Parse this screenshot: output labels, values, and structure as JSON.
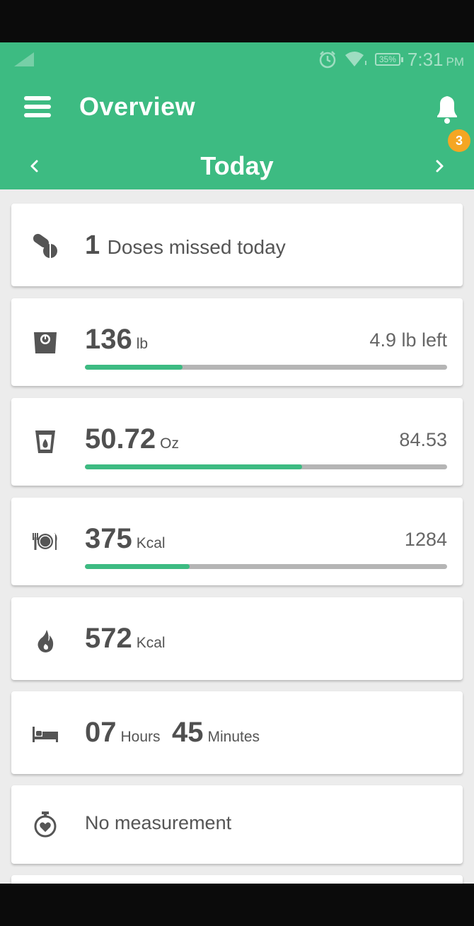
{
  "status_bar": {
    "battery": "35%",
    "time": "7:31",
    "ampm": "PM"
  },
  "header": {
    "title": "Overview",
    "notification_count": "3",
    "day": "Today"
  },
  "cards": {
    "doses": {
      "value": "1",
      "text": "Doses missed today"
    },
    "weight": {
      "value": "136",
      "unit": "lb",
      "right": "4.9 lb left",
      "progress": 0.27
    },
    "water": {
      "value": "50.72",
      "unit": "Oz",
      "right": "84.53",
      "progress": 0.6
    },
    "food": {
      "value": "375",
      "unit": "Kcal",
      "right": "1284",
      "progress": 0.29
    },
    "burned": {
      "value": "572",
      "unit": "Kcal"
    },
    "sleep": {
      "hours": "07",
      "hours_unit": "Hours",
      "minutes": "45",
      "minutes_unit": "Minutes"
    },
    "heart": {
      "text": "No measurement"
    }
  },
  "colors": {
    "accent": "#3dbb82",
    "badge": "#f5a623"
  }
}
